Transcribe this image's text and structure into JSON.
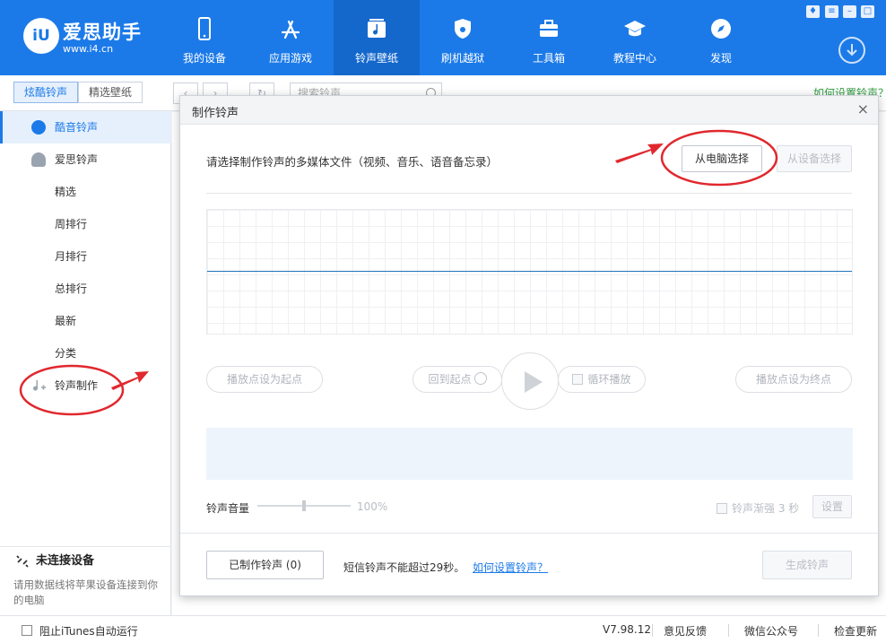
{
  "app": {
    "logo_mark": "iU",
    "logo_name": "爱思助手",
    "logo_url": "www.i4.cn"
  },
  "nav": [
    {
      "label": "我的设备",
      "icon": "phone-icon"
    },
    {
      "label": "应用游戏",
      "icon": "app-store-icon"
    },
    {
      "label": "铃声壁纸",
      "icon": "music-note-icon",
      "active": true
    },
    {
      "label": "刷机越狱",
      "icon": "shield-icon"
    },
    {
      "label": "工具箱",
      "icon": "toolbox-icon"
    },
    {
      "label": "教程中心",
      "icon": "graduation-cap-icon"
    },
    {
      "label": "发现",
      "icon": "compass-icon"
    }
  ],
  "subbar": {
    "tabs": [
      "炫酷铃声",
      "精选壁纸"
    ],
    "search_placeholder": "搜索铃声",
    "howto": "如何设置铃声？"
  },
  "sidebar": {
    "items": [
      {
        "label": "酷音铃声",
        "active": true
      },
      {
        "label": "爱思铃声"
      },
      {
        "label": "精选"
      },
      {
        "label": "周排行"
      },
      {
        "label": "月排行"
      },
      {
        "label": "总排行"
      },
      {
        "label": "最新"
      },
      {
        "label": "分类"
      },
      {
        "label": "铃声制作"
      }
    ],
    "connection_title": "未连接设备",
    "connection_desc": "请用数据线将苹果设备连接到你的电脑"
  },
  "dialog": {
    "title": "制作铃声",
    "close": "×",
    "prompt": "请选择制作铃声的多媒体文件（视频、音乐、语音备忘录）",
    "from_pc": "从电脑选择",
    "from_device": "从设备选择",
    "set_start": "播放点设为起点",
    "back_to_start": "回到起点",
    "loop": "循环播放",
    "set_end": "播放点设为终点",
    "volume_label": "铃声音量",
    "volume_value": "100%",
    "fade_label": "铃声渐强",
    "fade_value": "3 秒",
    "settings": "设置",
    "made_ringtones": "已制作铃声 (0)",
    "sms_note": "短信铃声不能超过29秒。",
    "howto_link": "如何设置铃声？",
    "generate": "生成铃声"
  },
  "statusbar": {
    "itunes_block": "阻止iTunes自动运行",
    "version": "V7.98.12",
    "feedback": "意见反馈",
    "wechat": "微信公众号",
    "update": "检查更新"
  },
  "colors": {
    "brand_blue": "#1c7ae8",
    "annotation_red": "#e0282e"
  }
}
